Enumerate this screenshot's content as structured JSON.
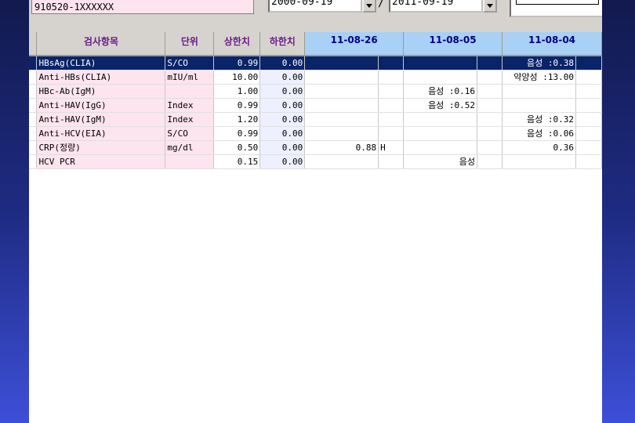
{
  "patient": {
    "id": "910520-1XXXXXX"
  },
  "date_range": {
    "from": "2000-09-19",
    "to": "2011-09-19",
    "separator": "/"
  },
  "colors": {
    "header_date_bg": "#a9d0f5",
    "selected_row": "#0a246a",
    "item_cell_bg": "#fde4ee",
    "high_flag": "#c00000"
  },
  "table": {
    "headers": {
      "item": "검사항목",
      "unit": "단위",
      "upper": "상한치",
      "lower": "하한치",
      "dates": [
        "11-08-26",
        "11-08-05",
        "11-08-04"
      ]
    },
    "rows": [
      {
        "item": "HBsAg(CLIA)",
        "unit": "S/CO",
        "upper": "0.99",
        "lower": "0.00",
        "d1": "",
        "d1f": "",
        "d2": "",
        "d2f": "",
        "d3": "음성 :0.38",
        "d3f": ""
      },
      {
        "item": "Anti-HBs(CLIA)",
        "unit": "mIU/ml",
        "upper": "10.00",
        "lower": "0.00",
        "d1": "",
        "d1f": "",
        "d2": "",
        "d2f": "",
        "d3": "약양성 :13.00",
        "d3f": ""
      },
      {
        "item": "HBc-Ab(IgM)",
        "unit": "",
        "upper": "1.00",
        "lower": "0.00",
        "d1": "",
        "d1f": "",
        "d2": "음성  :0.16",
        "d2f": "",
        "d3": "",
        "d3f": ""
      },
      {
        "item": "Anti-HAV(IgG)",
        "unit": "Index",
        "upper": "0.99",
        "lower": "0.00",
        "d1": "",
        "d1f": "",
        "d2": "음성 :0.52",
        "d2f": "",
        "d3": "",
        "d3f": ""
      },
      {
        "item": "Anti-HAV(IgM)",
        "unit": "Index",
        "upper": "1.20",
        "lower": "0.00",
        "d1": "",
        "d1f": "",
        "d2": "",
        "d2f": "",
        "d3": "음성 :0.32",
        "d3f": ""
      },
      {
        "item": "Anti-HCV(EIA)",
        "unit": "S/CO",
        "upper": "0.99",
        "lower": "0.00",
        "d1": "",
        "d1f": "",
        "d2": "",
        "d2f": "",
        "d3": "음성 :0.06",
        "d3f": ""
      },
      {
        "item": "CRP(정량)",
        "unit": "mg/dl",
        "upper": "0.50",
        "lower": "0.00",
        "d1": "0.88",
        "d1f": "H",
        "d2": "",
        "d2f": "",
        "d3": "0.36",
        "d3f": ""
      },
      {
        "item": "HCV PCR",
        "unit": "",
        "upper": "0.15",
        "lower": "0.00",
        "d1": "",
        "d1f": "",
        "d2": "음성",
        "d2f": "",
        "d3": "",
        "d3f": ""
      }
    ]
  }
}
